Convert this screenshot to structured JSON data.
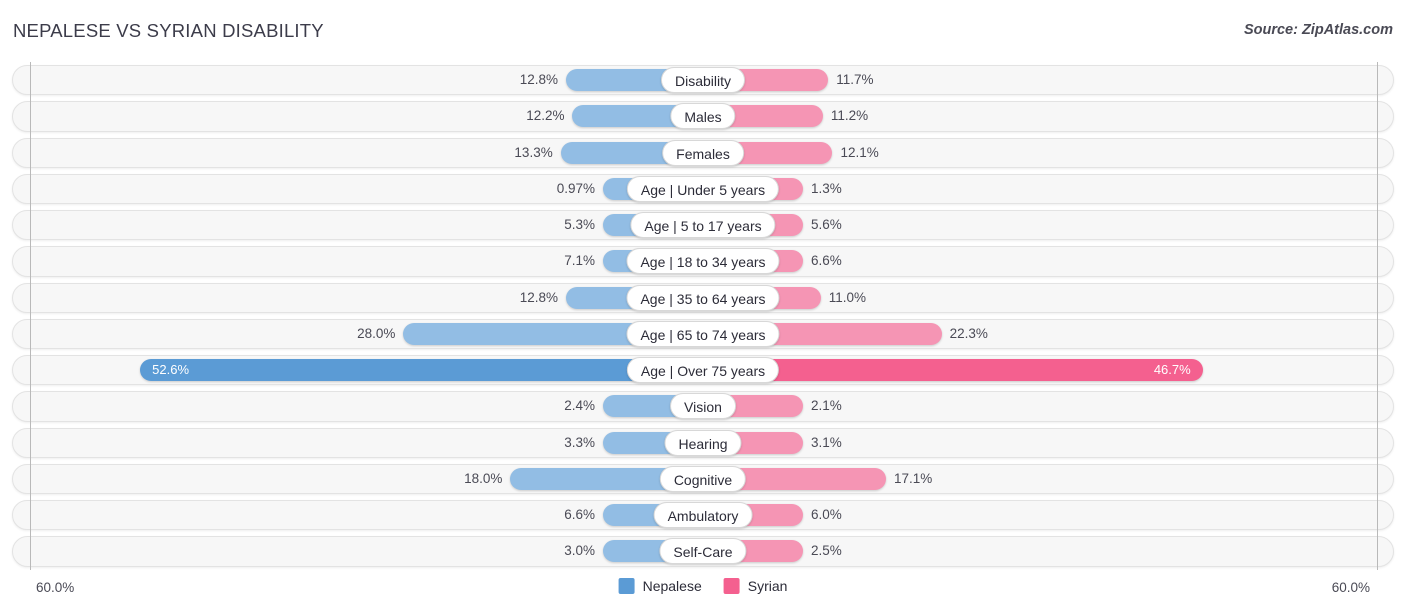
{
  "header": {
    "title": "NEPALESE VS SYRIAN DISABILITY",
    "source": "Source: ZipAtlas.com"
  },
  "axis": {
    "left_tick": "60.0%",
    "right_tick": "60.0%",
    "max": 60.0
  },
  "legend": {
    "items": [
      {
        "label": "Nepalese",
        "color": "#5b9bd5"
      },
      {
        "label": "Syrian",
        "color": "#f4608f"
      }
    ]
  },
  "colors": {
    "left_bar": "#92bde4",
    "right_bar": "#f595b4",
    "left_bar_highlight": "#5b9bd5",
    "right_bar_highlight": "#f4608f",
    "track": "#f7f7f7",
    "axis": "#b9b9b9"
  },
  "chart_data": {
    "type": "bar",
    "title": "NEPALESE VS SYRIAN DISABILITY",
    "subtitle": "Source: ZipAtlas.com",
    "orientation": "horizontal-diverging",
    "xlabel": "",
    "ylabel": "",
    "xlim": [
      60.0,
      60.0
    ],
    "grid": false,
    "legend_position": "bottom-center",
    "categories": [
      "Disability",
      "Males",
      "Females",
      "Age | Under 5 years",
      "Age | 5 to 17 years",
      "Age | 18 to 34 years",
      "Age | 35 to 64 years",
      "Age | 65 to 74 years",
      "Age | Over 75 years",
      "Vision",
      "Hearing",
      "Cognitive",
      "Ambulatory",
      "Self-Care"
    ],
    "series": [
      {
        "name": "Nepalese",
        "color": "#5b9bd5",
        "values": [
          12.8,
          12.2,
          13.3,
          0.97,
          5.3,
          7.1,
          12.8,
          28.0,
          52.6,
          2.4,
          3.3,
          18.0,
          6.6,
          3.0
        ],
        "labels": [
          "12.8%",
          "12.2%",
          "13.3%",
          "0.97%",
          "5.3%",
          "7.1%",
          "12.8%",
          "28.0%",
          "52.6%",
          "2.4%",
          "3.3%",
          "18.0%",
          "6.6%",
          "3.0%"
        ]
      },
      {
        "name": "Syrian",
        "color": "#f4608f",
        "values": [
          11.7,
          11.2,
          12.1,
          1.3,
          5.6,
          6.6,
          11.0,
          22.3,
          46.7,
          2.1,
          3.1,
          17.1,
          6.0,
          2.5
        ],
        "labels": [
          "11.7%",
          "11.2%",
          "12.1%",
          "1.3%",
          "5.6%",
          "6.6%",
          "11.0%",
          "22.3%",
          "46.7%",
          "2.1%",
          "3.1%",
          "17.1%",
          "6.0%",
          "2.5%"
        ]
      }
    ],
    "highlight_row_index": 8
  }
}
